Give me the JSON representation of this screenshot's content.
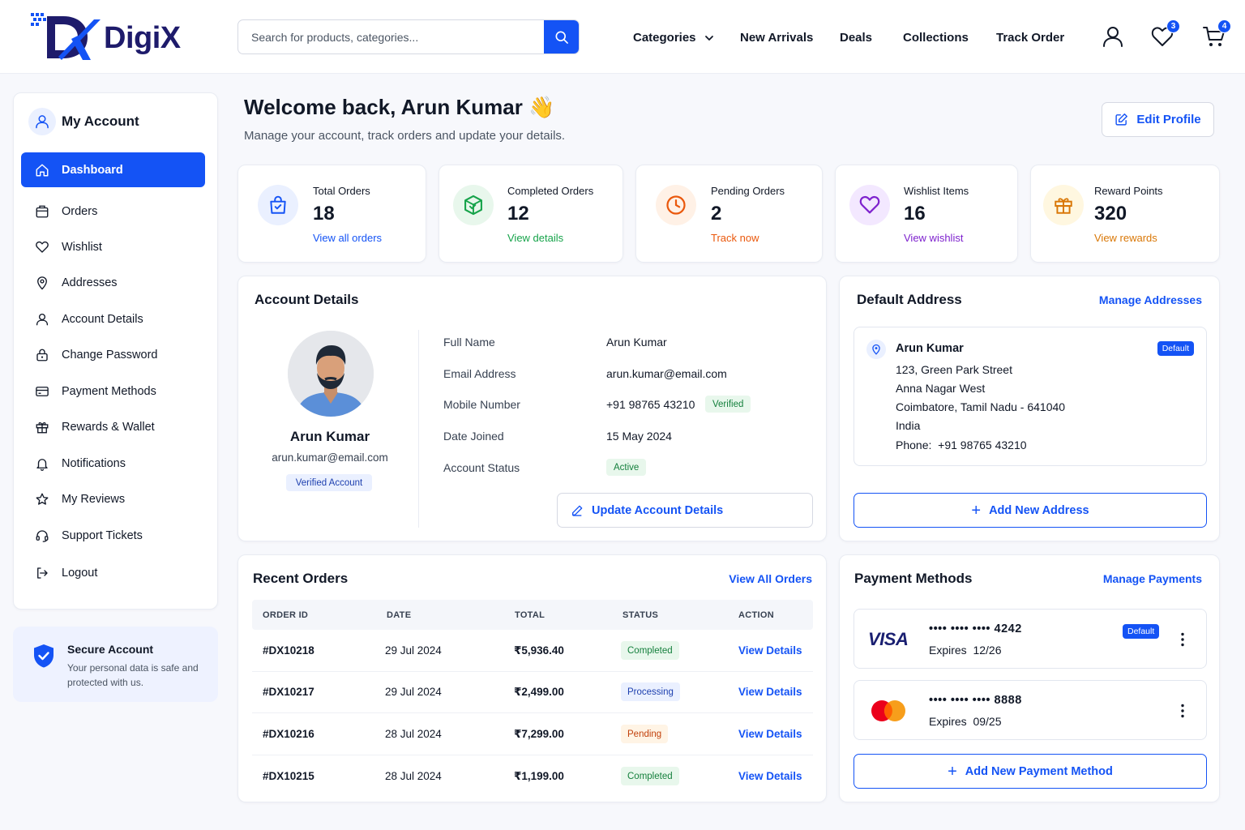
{
  "brand": {
    "name": "DigiX",
    "accent": "#1453f5",
    "navy": "#1e1b6b"
  },
  "header": {
    "search_placeholder": "Search for products, categories...",
    "nav": [
      "Categories",
      "New Arrivals",
      "Deals",
      "Collections",
      "Track Order"
    ],
    "wishlist_count": "3",
    "cart_count": "4"
  },
  "sidebar": {
    "title": "My Account",
    "items": [
      {
        "label": "Dashboard",
        "icon": "home-icon",
        "active": true
      },
      {
        "label": "Orders",
        "icon": "orders-icon"
      },
      {
        "label": "Wishlist",
        "icon": "heart-icon"
      },
      {
        "label": "Addresses",
        "icon": "location-pin-icon"
      },
      {
        "label": "Account Details",
        "icon": "user-icon"
      },
      {
        "label": "Change Password",
        "icon": "lock-icon"
      },
      {
        "label": "Payment Methods",
        "icon": "credit-card-icon"
      },
      {
        "label": "Rewards & Wallet",
        "icon": "gift-icon"
      },
      {
        "label": "Notifications",
        "icon": "bell-icon"
      },
      {
        "label": "My Reviews",
        "icon": "star-icon"
      },
      {
        "label": "Support Tickets",
        "icon": "headset-icon"
      },
      {
        "label": "Logout",
        "icon": "logout-icon"
      }
    ],
    "secure": {
      "title": "Secure Account",
      "desc": "Your personal data is safe and protected with us."
    }
  },
  "welcome": {
    "title": "Welcome back, Arun Kumar 👋",
    "subtitle": "Manage your account, track orders and update your details.",
    "edit_profile": "Edit Profile"
  },
  "stats": [
    {
      "label": "Total Orders",
      "value": "18",
      "link": "View all orders",
      "color": "#1453f5"
    },
    {
      "label": "Completed Orders",
      "value": "12",
      "link": "View details",
      "color": "#16a34a"
    },
    {
      "label": "Pending Orders",
      "value": "2",
      "link": "Track now",
      "color": "#ea580c"
    },
    {
      "label": "Wishlist Items",
      "value": "16",
      "link": "View wishlist",
      "color": "#7e22ce"
    },
    {
      "label": "Reward Points",
      "value": "320",
      "link": "View rewards",
      "color": "#d97706"
    }
  ],
  "account": {
    "title": "Account Details",
    "name": "Arun Kumar",
    "email": "arun.kumar@email.com",
    "verified_badge": "Verified Account",
    "fields": [
      {
        "label": "Full Name",
        "value": "Arun Kumar"
      },
      {
        "label": "Email Address",
        "value": "arun.kumar@email.com"
      },
      {
        "label": "Mobile Number",
        "value": "+91 98765 43210",
        "tag": "Verified"
      },
      {
        "label": "Date Joined",
        "value": "15 May 2024"
      },
      {
        "label": "Account Status",
        "value": "",
        "tag": "Active"
      }
    ],
    "update_button": "Update Account Details"
  },
  "address": {
    "title": "Default Address",
    "manage_link": "Manage Addresses",
    "name": "Arun Kumar",
    "badge": "Default",
    "lines": [
      "123, Green Park Street",
      "Anna Nagar West",
      "Coimbatore, Tamil Nadu - 641040",
      "India",
      "Phone:  +91 98765 43210"
    ],
    "add_button": "Add New Address"
  },
  "orders": {
    "title": "Recent Orders",
    "view_all": "View All Orders",
    "columns": [
      "ORDER ID",
      "DATE",
      "TOTAL",
      "STATUS",
      "ACTION"
    ],
    "rows": [
      {
        "id": "#DX10218",
        "date": "29 Jul 2024",
        "total": "₹5,936.40",
        "status": "Completed",
        "action": "View Details"
      },
      {
        "id": "#DX10217",
        "date": "29 Jul 2024",
        "total": "₹2,499.00",
        "status": "Processing",
        "action": "View Details"
      },
      {
        "id": "#DX10216",
        "date": "28 Jul 2024",
        "total": "₹7,299.00",
        "status": "Pending",
        "action": "View Details"
      },
      {
        "id": "#DX10215",
        "date": "28 Jul 2024",
        "total": "₹1,199.00",
        "status": "Completed",
        "action": "View Details"
      }
    ]
  },
  "payments": {
    "title": "Payment Methods",
    "manage_link": "Manage Payments",
    "cards": [
      {
        "brand": "VISA",
        "number": "•••• •••• •••• 4242",
        "expires": "Expires  12/26",
        "badge": "Default"
      },
      {
        "brand": "mastercard",
        "number": "•••• •••• •••• 8888",
        "expires": "Expires  09/25"
      }
    ],
    "add_button": "Add New Payment Method"
  }
}
